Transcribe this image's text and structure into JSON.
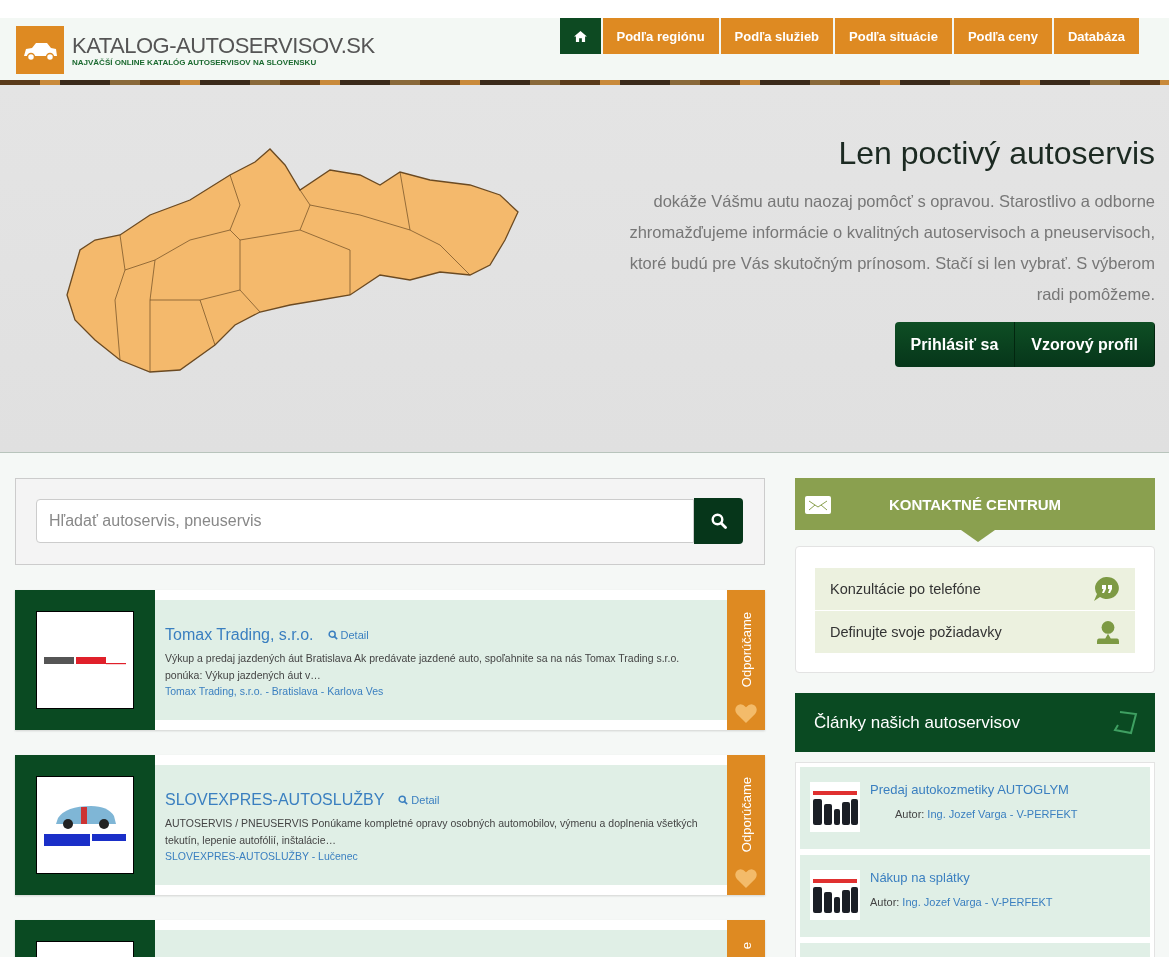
{
  "header": {
    "brand": "KATALOG-AUTOSERVISOV.SK",
    "tagline": "NAJVÄČŠÍ ONLINE KATALÓG AUTOSERVISOV NA SLOVENSKU"
  },
  "nav": [
    {
      "kind": "home",
      "selected": true
    },
    {
      "kind": "link",
      "label": "Podľa regiónu",
      "selected": false
    },
    {
      "kind": "link",
      "label": "Podľa služieb",
      "selected": false
    },
    {
      "kind": "link",
      "label": "Podľa situácie",
      "selected": false
    },
    {
      "kind": "link",
      "label": "Podľa ceny",
      "selected": false
    },
    {
      "kind": "link",
      "label": "Databáza",
      "selected": false
    }
  ],
  "hero": {
    "title": "Len poctivý autoservis",
    "text": "dokáže Vášmu autu naozaj pomôcť s opravou. Starostlivo a odborne zhromažďujeme informácie o kvalitných autoservisoch a pneuservisoch, ktoré budú pre Vás skutočným prínosom. Stačí si len vybrať. S výberom radi pomôžeme.",
    "buttons": [
      "Prihlásiť sa",
      "Vzorový profil"
    ]
  },
  "search": {
    "placeholder": "Hľadať autoservis, pneuservis"
  },
  "listings": [
    {
      "name": "Tomax Trading, s.r.o.",
      "detail": "Detail",
      "description": "Výkup a predaj jazdených áut Bratislava  Ak predávate jazdené auto, spoľahnite sa na nás   Tomax Trading s.r.o. ponúka: Výkup jazdených áut v…",
      "address": "Tomax Trading, s.r.o. - Bratislava - Karlova Ves",
      "badge": "Odporúčame"
    },
    {
      "name": "SLOVEXPRES-AUTOSLUŽBY",
      "detail": "Detail",
      "description": "AUTOSERVIS / PNEUSERVIS Ponúkame kompletné opravy osobných automobilov, výmenu a doplnenia všetkých tekutín, lepenie autofólií, inštalácie…",
      "address": "SLOVEXPRES-AUTOSLUŽBY - Lučenec",
      "badge": "Odporúčame"
    },
    {
      "badge": "e"
    }
  ],
  "contact": {
    "title": "KONTAKTNÉ CENTRUM",
    "items": [
      {
        "label": "Konzultácie po telefóne",
        "kind": "chat"
      },
      {
        "label": "Definujte svoje požiadavky",
        "kind": "person"
      }
    ]
  },
  "articles": {
    "title": "Články našich autoservisov",
    "items": [
      {
        "title": "Predaj autokozmetiky AUTOGLYM",
        "author_label": "Autor:",
        "author": "Ing. Jozef Varga - V-PERFEKT",
        "indented": true
      },
      {
        "title": "Nákup na splátky",
        "author_label": "Autor:",
        "author": "Ing. Jozef Varga - V-PERFEKT",
        "indented": false
      }
    ]
  }
}
